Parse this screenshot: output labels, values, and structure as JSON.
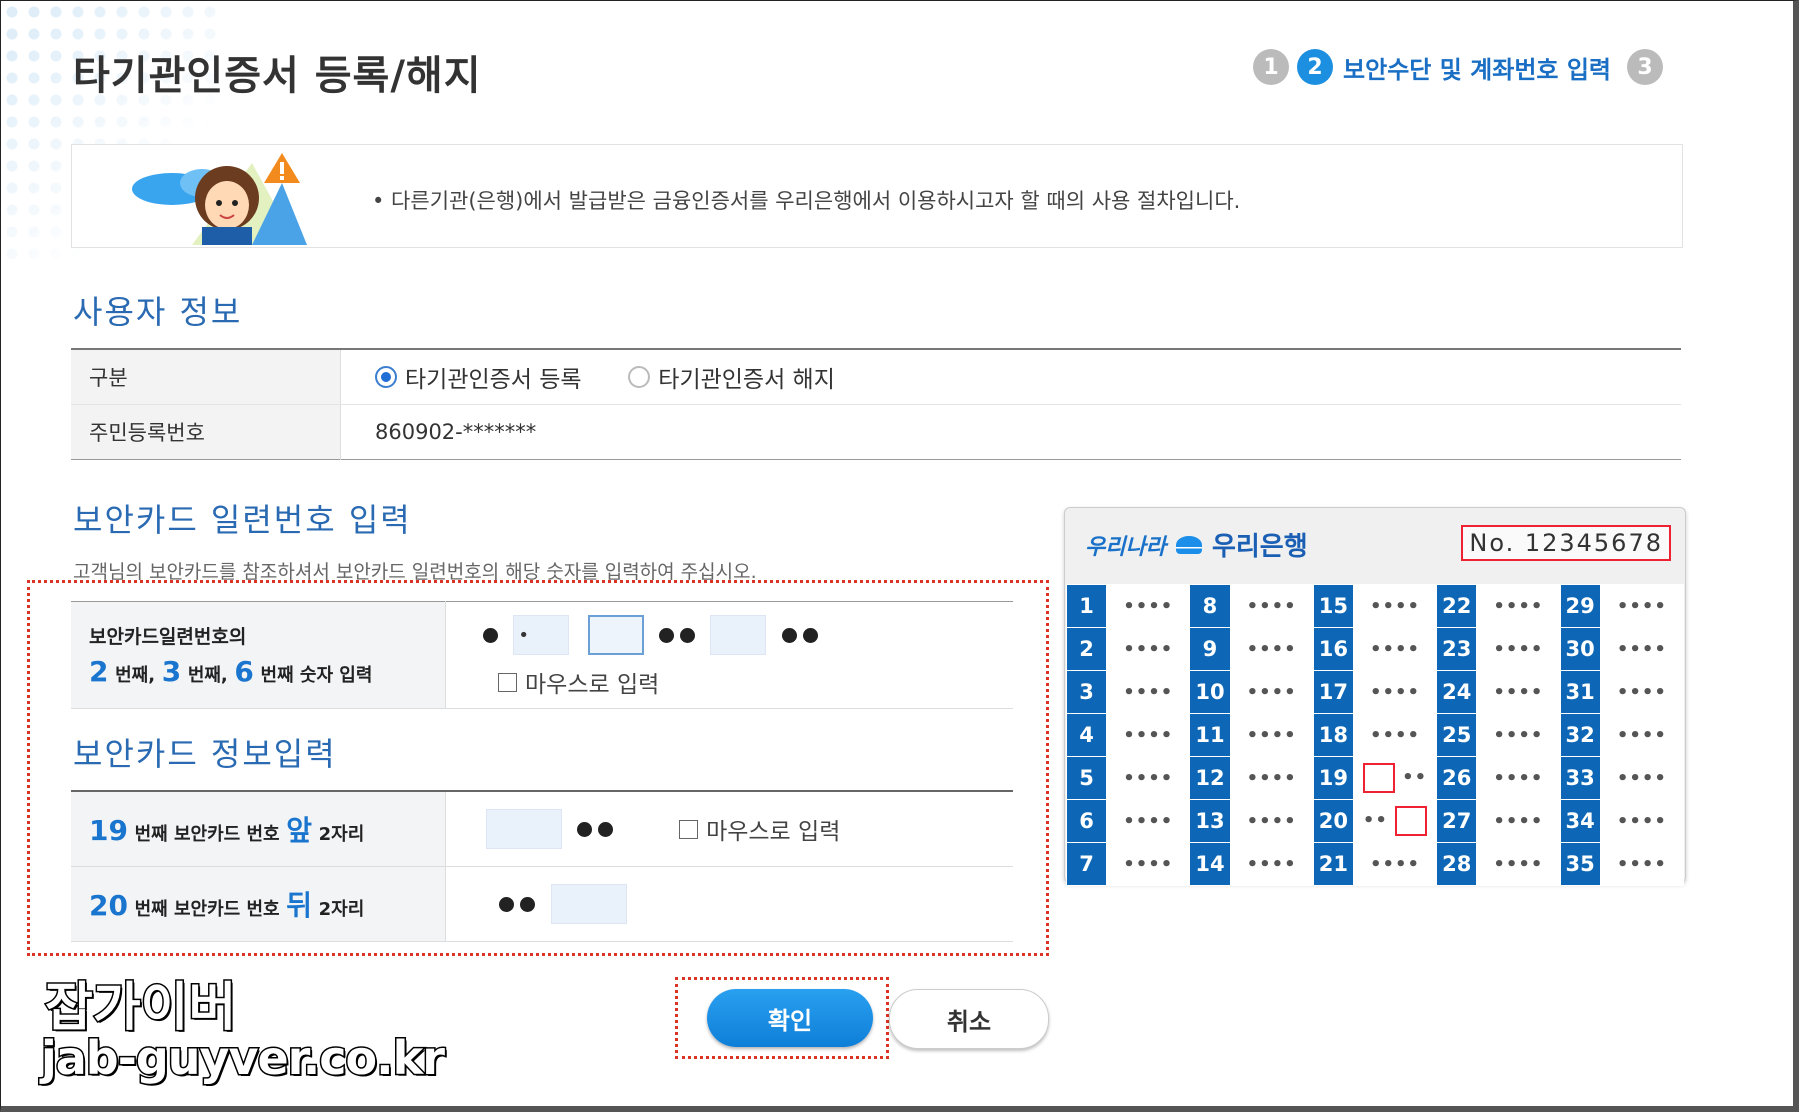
{
  "page": {
    "title": "타기관인증서 등록/해지"
  },
  "steps": [
    {
      "num": "1",
      "label": "",
      "active": false
    },
    {
      "num": "2",
      "label": "보안수단 및 계좌번호 입력",
      "active": true
    },
    {
      "num": "3",
      "label": "",
      "active": false
    }
  ],
  "notice": {
    "text": "• 다른기관(은행)에서 발급받은 금융인증서를 우리은행에서 이용하시고자 할 때의 사용 절차입니다."
  },
  "user_info": {
    "section_title": "사용자 정보",
    "rows": {
      "type_label": "구분",
      "option_register": "타기관인증서 등록",
      "option_cancel": "타기관인증서 해지",
      "rrn_label": "주민등록번호",
      "rrn_value": "860902-*******"
    }
  },
  "serial": {
    "section_title": "보안카드 일련번호 입력",
    "description": "고객님의 보안카드를 참조하셔서 보안카드 일련번호의 해당 숫자를 입력하여 주십시오.",
    "label_line1": "보안카드일련번호의",
    "num_a": "2",
    "num_b": "3",
    "num_c": "6",
    "word_beonjjae": "번째,",
    "word_beonjjae_last": "번째 숫자 입력",
    "input1_value": "•",
    "mouse_label": "마우스로 입력"
  },
  "card_info": {
    "section_title": "보안카드 정보입력",
    "row1": {
      "num": "19",
      "mid": "번째 보안카드 번호",
      "pos": "앞",
      "tail": "2자리"
    },
    "row2": {
      "num": "20",
      "mid": "번째 보안카드 번호",
      "pos": "뒤",
      "tail": "2자리"
    },
    "mouse_label": "마우스로 입력"
  },
  "security_card": {
    "slogan": "우리나라",
    "bank": "우리은행",
    "number": "No. 12345678",
    "masked": "••••",
    "half_masked": "••",
    "columns": [
      [
        "1",
        "2",
        "3",
        "4",
        "5",
        "6",
        "7"
      ],
      [
        "8",
        "9",
        "10",
        "11",
        "12",
        "13",
        "14"
      ],
      [
        "15",
        "16",
        "17",
        "18",
        "19",
        "20",
        "21"
      ],
      [
        "22",
        "23",
        "24",
        "25",
        "26",
        "27",
        "28"
      ],
      [
        "29",
        "30",
        "31",
        "32",
        "33",
        "34",
        "35"
      ]
    ]
  },
  "buttons": {
    "confirm": "확인",
    "cancel": "취소"
  },
  "watermark": {
    "line1": "잡가이버",
    "line2": "jab-guyver.co.kr"
  },
  "colors": {
    "accent": "#1a75cf",
    "card_blue": "#0e67b6",
    "highlight_red": "#dd3322"
  }
}
